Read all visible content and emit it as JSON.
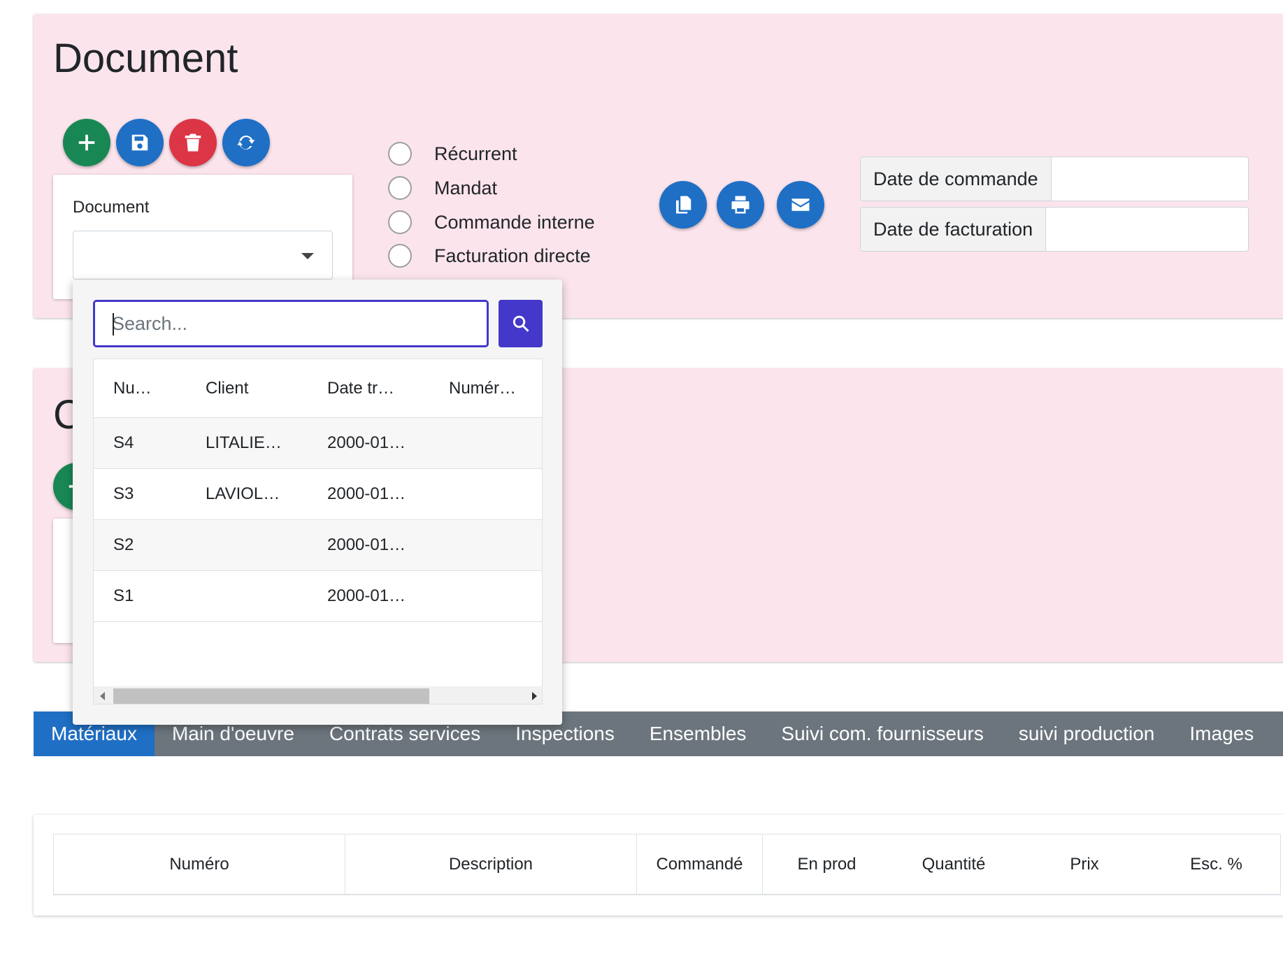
{
  "header": {
    "title": "Document"
  },
  "toolbar": {
    "add_icon": "plus-icon",
    "save_icon": "save-icon",
    "delete_icon": "trash-icon",
    "refresh_icon": "refresh-icon",
    "copy_icon": "copy-icon",
    "print_icon": "print-icon",
    "email_icon": "envelope-icon"
  },
  "document_field": {
    "label": "Document",
    "value": ""
  },
  "options": [
    {
      "label": "Récurrent",
      "checked": false
    },
    {
      "label": "Mandat",
      "checked": false
    },
    {
      "label": "Commande interne",
      "checked": false
    },
    {
      "label": "Facturation directe",
      "checked": false
    }
  ],
  "dates": {
    "order_label": "Date de commande",
    "order_value": "",
    "invoice_label": "Date de facturation",
    "invoice_value": ""
  },
  "section2": {
    "title": "C"
  },
  "dropdown": {
    "search_placeholder": "Search...",
    "columns": [
      "Nu…",
      "Client",
      "Date tr…",
      "Numér…"
    ],
    "rows": [
      {
        "num": "S4",
        "client": "LITALIE…",
        "date": "2000-01…",
        "numero": ""
      },
      {
        "num": "S3",
        "client": "LAVIOL…",
        "date": "2000-01…",
        "numero": ""
      },
      {
        "num": "S2",
        "client": "",
        "date": "2000-01…",
        "numero": ""
      },
      {
        "num": "S1",
        "client": "",
        "date": "2000-01…",
        "numero": ""
      }
    ]
  },
  "tabs": [
    {
      "label": "Matériaux",
      "active": true
    },
    {
      "label": "Main d'oeuvre",
      "active": false
    },
    {
      "label": "Contrats services",
      "active": false
    },
    {
      "label": "Inspections",
      "active": false
    },
    {
      "label": "Ensembles",
      "active": false
    },
    {
      "label": "Suivi com. fournisseurs",
      "active": false
    },
    {
      "label": "suivi production",
      "active": false
    },
    {
      "label": "Images",
      "active": false
    }
  ],
  "materials_table": {
    "columns": [
      "Numéro",
      "Description",
      "Commandé",
      "En prod",
      "Quantité",
      "Prix",
      "Esc. %"
    ]
  },
  "colors": {
    "section_bg": "#fce4ec",
    "primary": "#1f6fc5",
    "success": "#198754",
    "danger": "#dc3545",
    "search_accent": "#4338ca",
    "tabs_bg": "#6c757d"
  }
}
